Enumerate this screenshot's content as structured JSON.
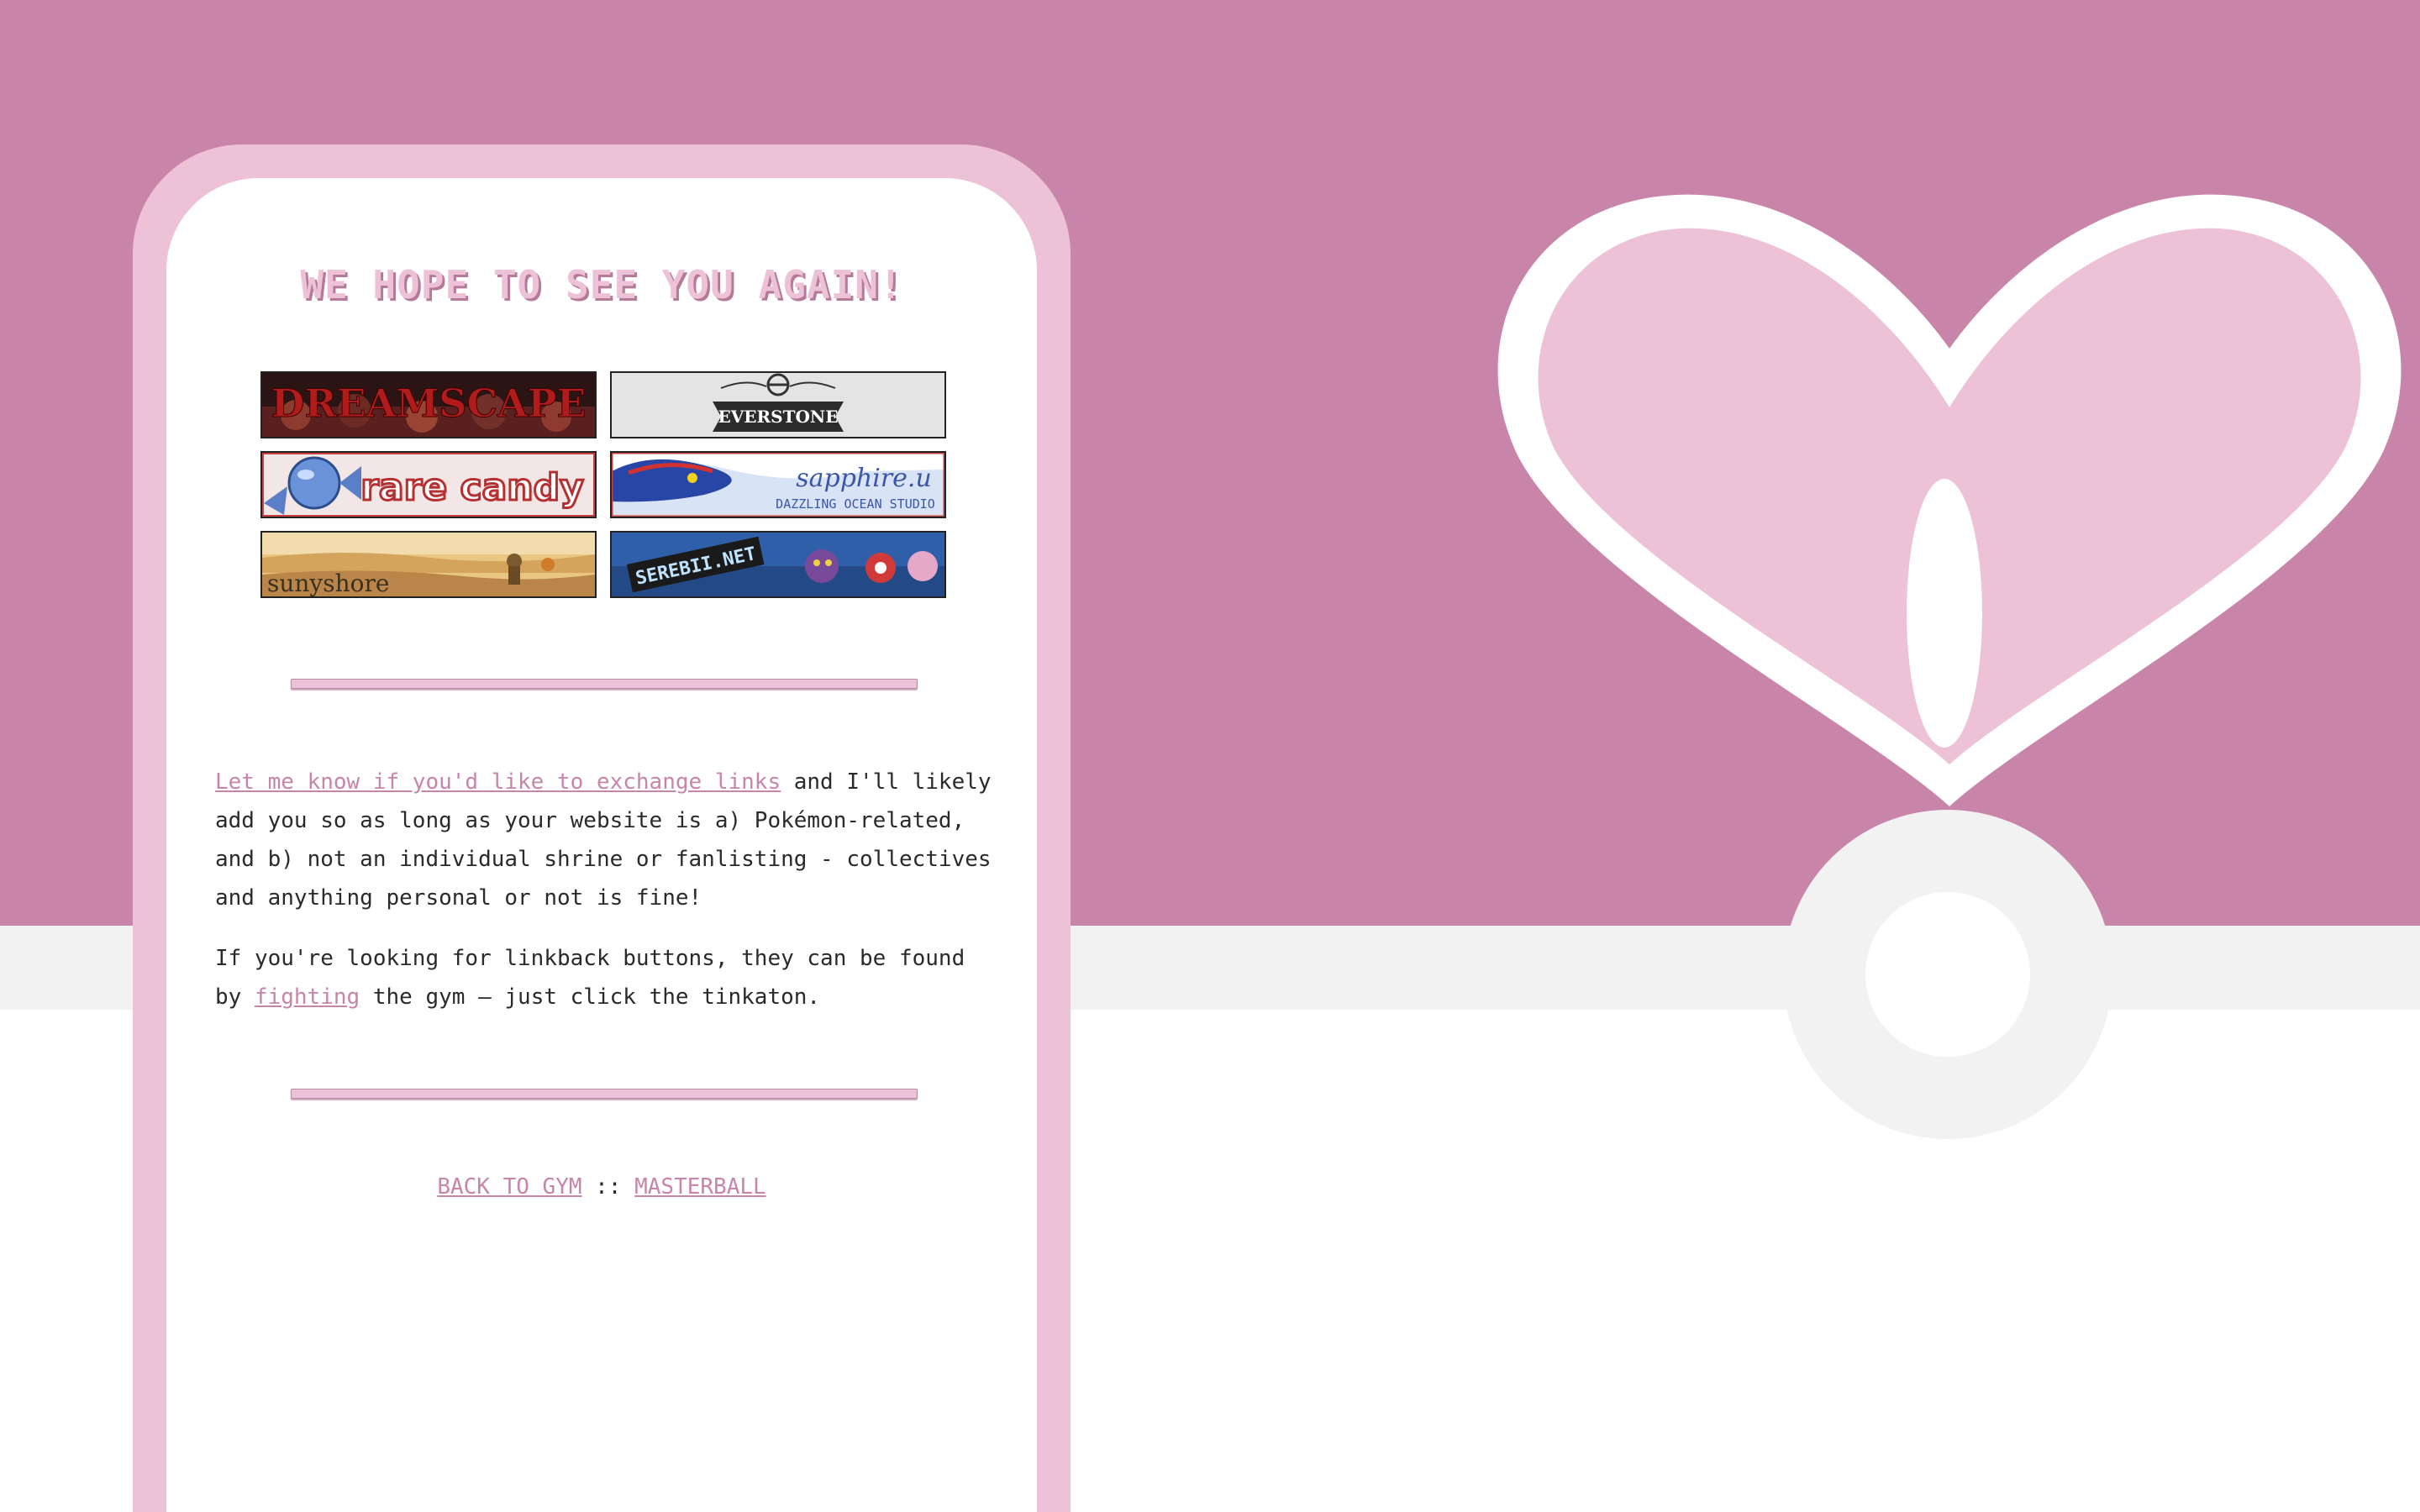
{
  "header": {
    "title": "WE HOPE TO SEE YOU AGAIN!"
  },
  "affiliates": [
    {
      "name": "DREAMSCAPE",
      "icon": "dreamscape-banner"
    },
    {
      "name": "EVERSTONE",
      "icon": "everstone-banner"
    },
    {
      "name": "rare candy",
      "icon": "rare-candy-banner"
    },
    {
      "name": "sapphire.u",
      "subtitle": "DAZZLING OCEAN STUDIO",
      "icon": "sapphire-banner"
    },
    {
      "name": "sunyshore",
      "icon": "sunyshore-banner"
    },
    {
      "name": "SEREBII.NET",
      "icon": "serebii-banner"
    }
  ],
  "content": {
    "p1_link": "Let me know if you'd like to exchange links",
    "p1_text": " and I'll likely add you so as long as your website is a) Pokémon-related, and b) not an individual shrine or fanlisting - collectives and anything personal or not is fine!",
    "p2_text_before": "If you're looking for linkback buttons, they can be found by ",
    "p2_link": "fighting",
    "p2_text_after": " the gym — just click the tinkaton."
  },
  "nav": {
    "back_label": "BACK TO GYM",
    "separator": " :: ",
    "masterball_label": "MASTERBALL"
  },
  "colors": {
    "background_top": "#c984a9",
    "background_band": "#f2f2f2",
    "card_border": "#edc1d6",
    "link": "#c984a9",
    "text": "#2a2a2a"
  }
}
